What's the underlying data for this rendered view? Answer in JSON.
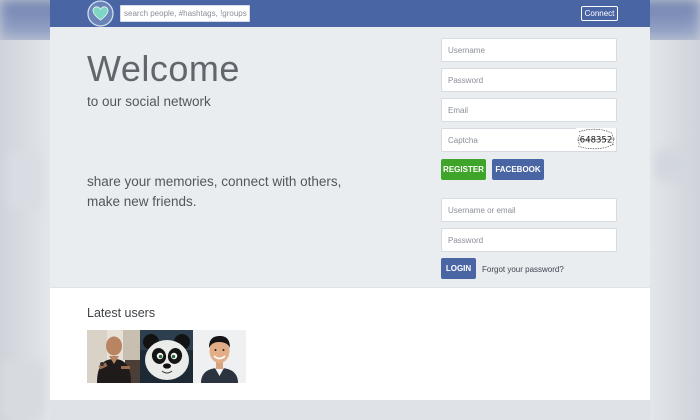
{
  "navbar": {
    "search_placeholder": "search people, #hashtags, !groups",
    "connect_label": "Connect"
  },
  "hero": {
    "welcome": "Welcome",
    "tagline": "to our social network",
    "pitch": "share your memories, connect with others, make new friends."
  },
  "register": {
    "username_placeholder": "Username",
    "password_placeholder": "Password",
    "email_placeholder": "Email",
    "captcha_placeholder": "Captcha",
    "captcha_code": "648352",
    "register_label": "REGISTER",
    "facebook_label": "FACEBOOK"
  },
  "login": {
    "username_placeholder": "Username or email",
    "password_placeholder": "Password",
    "login_label": "LOGIN",
    "forgot_label": "Forgot your password?"
  },
  "latest_users": {
    "title": "Latest users",
    "users": [
      {
        "icon": "man-with-microphone-avatar"
      },
      {
        "icon": "panda-avatar"
      },
      {
        "icon": "smiling-man-avatar"
      }
    ]
  },
  "colors": {
    "navbar": "#4a65a4",
    "register": "#3ea52a",
    "facebook": "#4a65a4",
    "hero_bg": "#e9edf0"
  }
}
